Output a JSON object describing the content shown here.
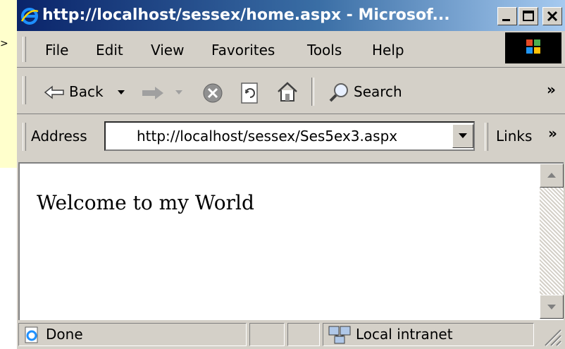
{
  "window": {
    "title": "http://localhost/sessex/home.aspx - Microsof...",
    "background_text": ">"
  },
  "menu": {
    "items": [
      "File",
      "Edit",
      "View",
      "Favorites",
      "Tools",
      "Help"
    ]
  },
  "toolbar": {
    "back_label": "Back",
    "search_label": "Search",
    "overflow_label": "»"
  },
  "address_bar": {
    "label": "Address",
    "url": "http://localhost/sessex/Ses5ex3.aspx",
    "links_label": "Links",
    "links_overflow": "»"
  },
  "page": {
    "welcome_text": "Welcome to my World"
  },
  "status_bar": {
    "status_text": "Done",
    "zone_text": "Local intranet"
  },
  "colors": {
    "title_gradient_start": "#0a246a",
    "title_gradient_end": "#a6caf0",
    "chrome": "#d4d0c8",
    "outer_background": "#ffffcc"
  }
}
